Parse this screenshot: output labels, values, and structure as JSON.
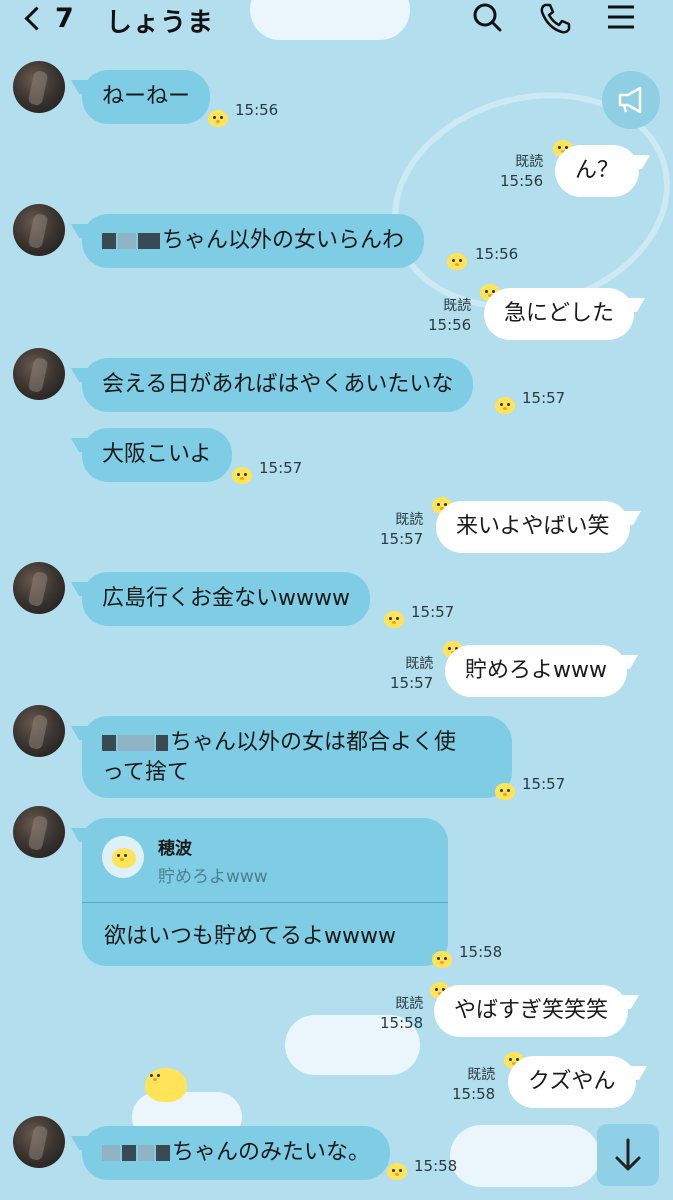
{
  "header": {
    "back_count": "7",
    "contact_name": "しょうま",
    "icons": [
      "search-icon",
      "phone-icon",
      "menu-icon"
    ]
  },
  "read_label": "既読",
  "messages": [
    {
      "dir": "in",
      "text": "ねーねー",
      "time": "15:56"
    },
    {
      "dir": "out",
      "text": "ん？",
      "time": "15:56",
      "read": "既読"
    },
    {
      "dir": "in",
      "text": "ちゃん以外の女いらんわ",
      "time": "15:56",
      "redacted_prefix": true
    },
    {
      "dir": "out",
      "text": "急にどした",
      "time": "15:56",
      "read": "既読"
    },
    {
      "dir": "in",
      "text": "会える日があればはやくあいたいな",
      "time": "15:57"
    },
    {
      "dir": "in",
      "text": "大阪こいよ",
      "time": "15:57"
    },
    {
      "dir": "out",
      "text": "来いよやばい笑",
      "time": "15:57",
      "read": "既読"
    },
    {
      "dir": "in",
      "text": "広島行くお金ないwwww",
      "time": "15:57"
    },
    {
      "dir": "out",
      "text": "貯めろよwww",
      "time": "15:57",
      "read": "既読"
    },
    {
      "dir": "in",
      "text_line1": "ちゃん以外の女は都合よく使",
      "text_line2": "って捨て",
      "time": "15:57",
      "redacted_prefix": true
    },
    {
      "dir": "in",
      "type": "reply",
      "quote_name": "穂波",
      "quote_text": "貯めろよwww",
      "text": "欲はいつも貯めてるよwwww",
      "time": "15:58"
    },
    {
      "dir": "out",
      "text": "やばすぎ笑笑笑",
      "time": "15:58",
      "read": "既読"
    },
    {
      "dir": "out",
      "text": "クズやん",
      "time": "15:58",
      "read": "既読"
    },
    {
      "dir": "in",
      "text": "ちゃんのみたいな。",
      "time": "15:58",
      "redacted_prefix": true
    }
  ],
  "colors": {
    "background": "#b2deee",
    "incoming_bubble": "#7fcde4",
    "outgoing_bubble": "#ffffff"
  }
}
